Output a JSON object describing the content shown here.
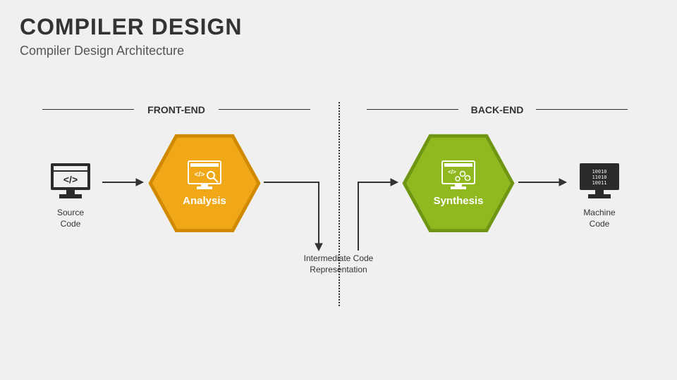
{
  "title": "COMPILER DESIGN",
  "subtitle": "Compiler Design Architecture",
  "sections": {
    "front": "FRONT-END",
    "back": "BACK-END"
  },
  "nodes": {
    "source": {
      "line1": "Source",
      "line2": "Code"
    },
    "analysis": "Analysis",
    "synthesis": "Synthesis",
    "machine": {
      "line1": "Machine",
      "line2": "Code"
    }
  },
  "intermediate": {
    "line1": "Intermediate Code",
    "line2": "Representation"
  },
  "colors": {
    "analysis_fill": "#f0a818",
    "analysis_stroke": "#d18a00",
    "synthesis_fill": "#8fb91e",
    "synthesis_stroke": "#6f9612",
    "icon_dark": "#2b2b2b"
  }
}
